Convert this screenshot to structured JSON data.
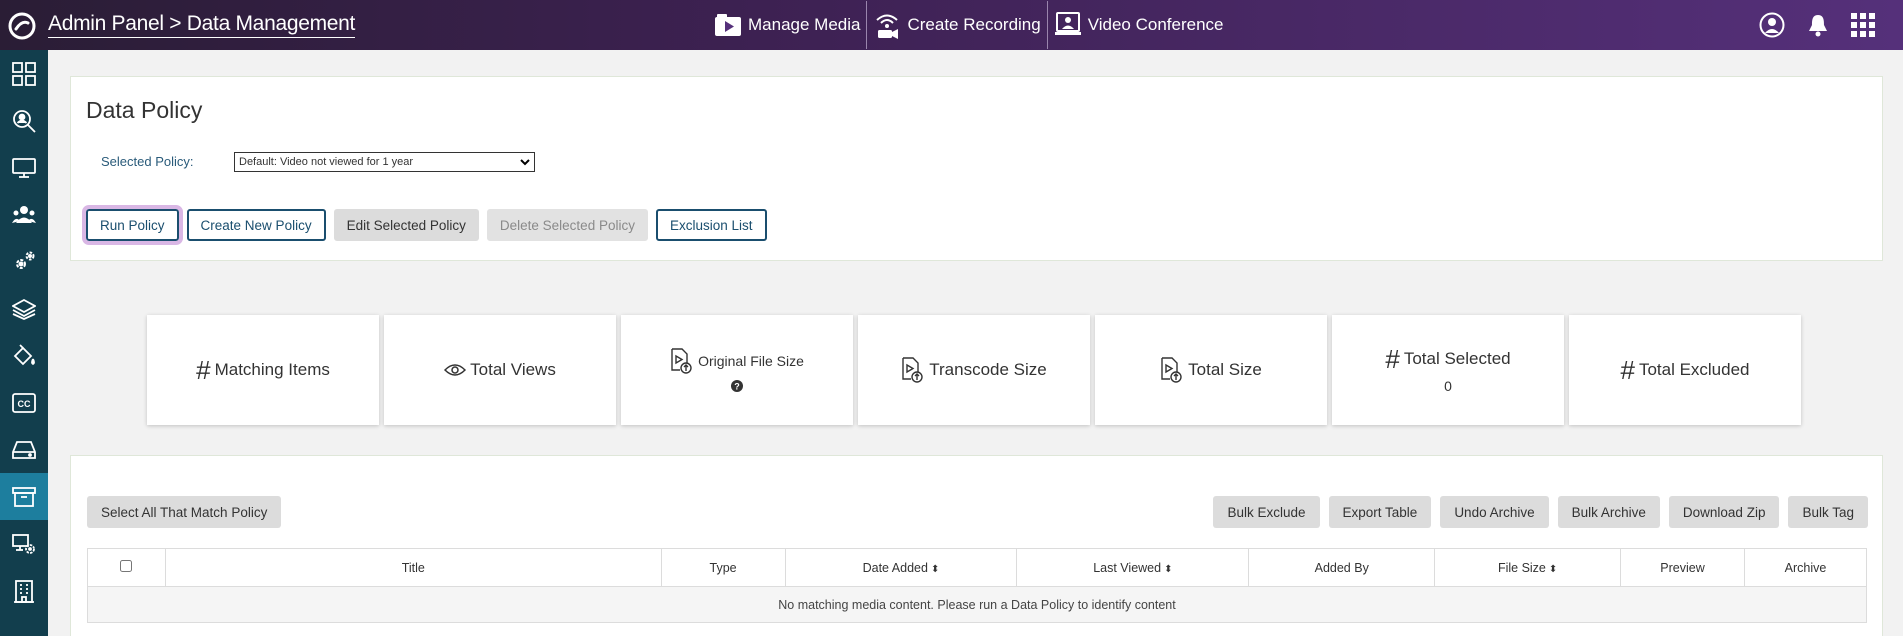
{
  "header": {
    "title": "Admin Panel > Data Management",
    "nav": [
      {
        "label": "Manage Media",
        "icon": "play-folder-icon"
      },
      {
        "label": "Create Recording",
        "icon": "broadcast-camera-icon"
      },
      {
        "label": "Video Conference",
        "icon": "presenter-icon"
      }
    ],
    "icons": [
      "user-icon",
      "bell-icon",
      "app-grid-icon"
    ]
  },
  "sidebar": {
    "items": [
      {
        "icon": "dashboard-grid-icon"
      },
      {
        "icon": "search-user-icon"
      },
      {
        "icon": "monitor-icon"
      },
      {
        "icon": "users-group-icon"
      },
      {
        "icon": "gears-icon"
      },
      {
        "icon": "layers-icon"
      },
      {
        "icon": "paint-bucket-icon"
      },
      {
        "icon": "closed-captions-icon"
      },
      {
        "icon": "hard-drive-icon"
      },
      {
        "icon": "archive-box-icon",
        "active": true
      },
      {
        "icon": "device-settings-icon"
      },
      {
        "icon": "building-icon"
      }
    ]
  },
  "policy": {
    "title": "Data Policy",
    "selected_label": "Selected Policy:",
    "selected_value": "Default: Video not viewed for 1 year",
    "buttons": {
      "run": "Run Policy",
      "create": "Create New Policy",
      "edit": "Edit Selected Policy",
      "delete": "Delete Selected Policy",
      "exclusion": "Exclusion List"
    }
  },
  "stats": {
    "matching": "Matching Items",
    "views": "Total Views",
    "original": "Original File Size",
    "transcode": "Transcode Size",
    "total_size": "Total Size",
    "selected": "Total Selected",
    "selected_value": "0",
    "excluded": "Total Excluded"
  },
  "table_tools": {
    "select_all": "Select All That Match Policy",
    "bulk_exclude": "Bulk Exclude",
    "export": "Export Table",
    "undo_archive": "Undo Archive",
    "bulk_archive": "Bulk Archive",
    "download_zip": "Download Zip",
    "bulk_tag": "Bulk Tag"
  },
  "table": {
    "columns": [
      "Title",
      "Type",
      "Date Added",
      "Last Viewed",
      "Added By",
      "File Size",
      "Preview",
      "Archive"
    ],
    "empty_message": "No matching media content. Please run a Data Policy to identify content"
  },
  "colors": {
    "header_start": "#2a1d35",
    "header_end": "#55307a",
    "sidebar": "#123e4d",
    "sidebar_active": "#1d7e9e",
    "accent": "#1a4e6e"
  }
}
